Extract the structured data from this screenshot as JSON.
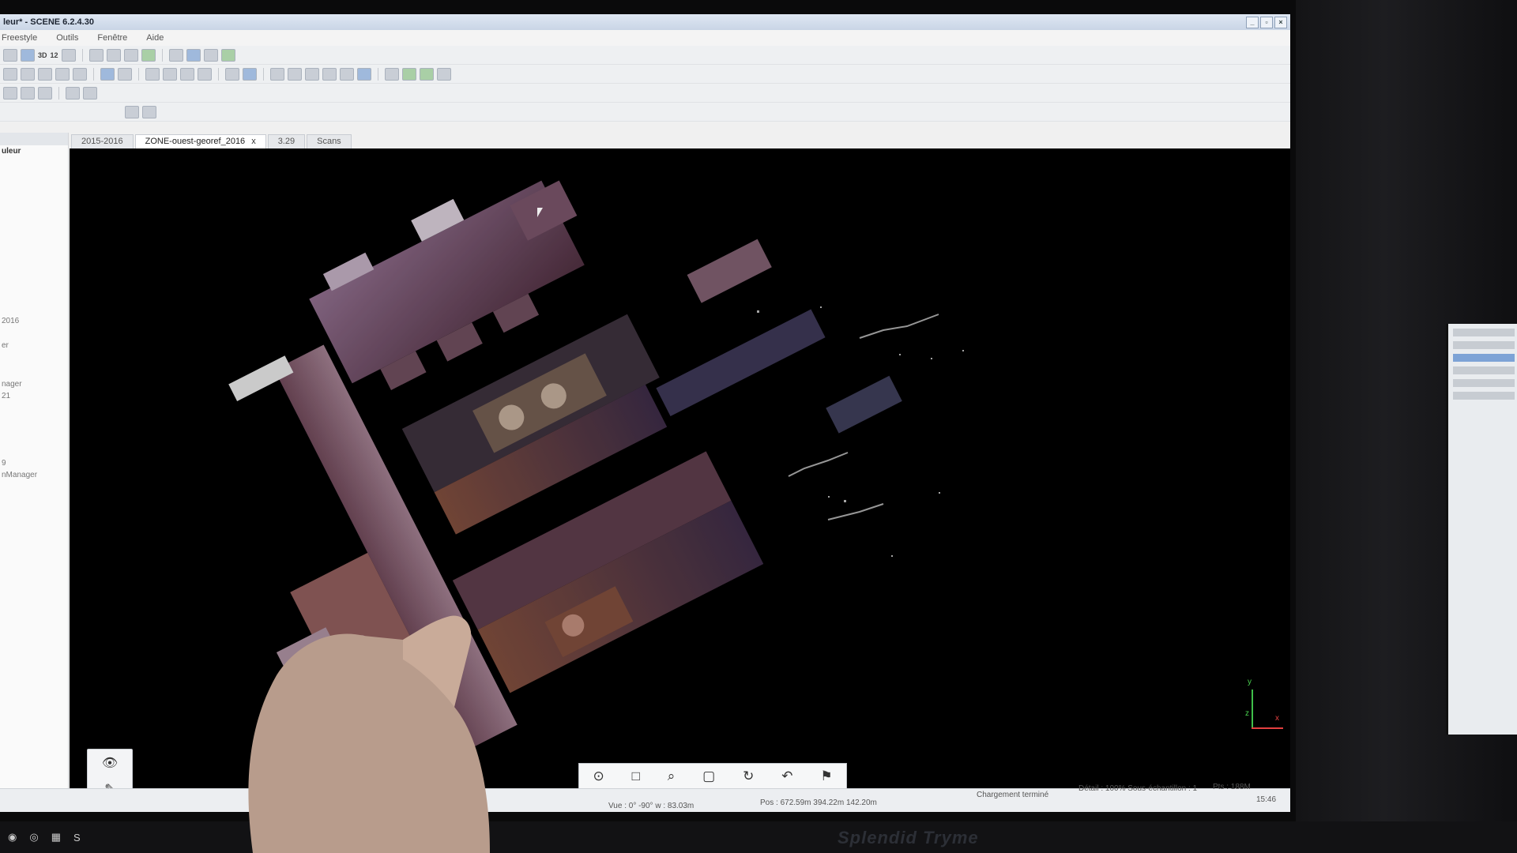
{
  "window": {
    "title": "leur* - SCENE 6.2.4.30",
    "controls": [
      "_",
      "▫",
      "×"
    ]
  },
  "menu": [
    "Freestyle",
    "Outils",
    "Fenêtre",
    "Aide"
  ],
  "toolbar_row1_text": [
    "3D",
    "12"
  ],
  "left_panel": {
    "header": "uleur",
    "items": [
      "2016",
      "er",
      "nager",
      "21",
      "9",
      "nManager"
    ]
  },
  "tabs": [
    {
      "label": "2015-2016"
    },
    {
      "label": "ZONE-ouest-georef_2016",
      "close": "x"
    },
    {
      "label": "3.29"
    },
    {
      "label": "Scans"
    }
  ],
  "axis": {
    "y": "y",
    "z": "z",
    "x": "x"
  },
  "status": {
    "view": "Vue : 0° -90° w : 83.03m",
    "pos": "Pos : 672.59m 394.22m 142.20m",
    "loading": "Chargement terminé",
    "detail": "Détail : 100% Sous-échantillon : 1",
    "points": "Pts : 188M",
    "time": "15:46"
  },
  "brand_text": "Splendid Tryme",
  "taskbar": [
    "S"
  ],
  "colors": {
    "viewport_bg": "#000000",
    "accent": "#9fb9dc"
  }
}
